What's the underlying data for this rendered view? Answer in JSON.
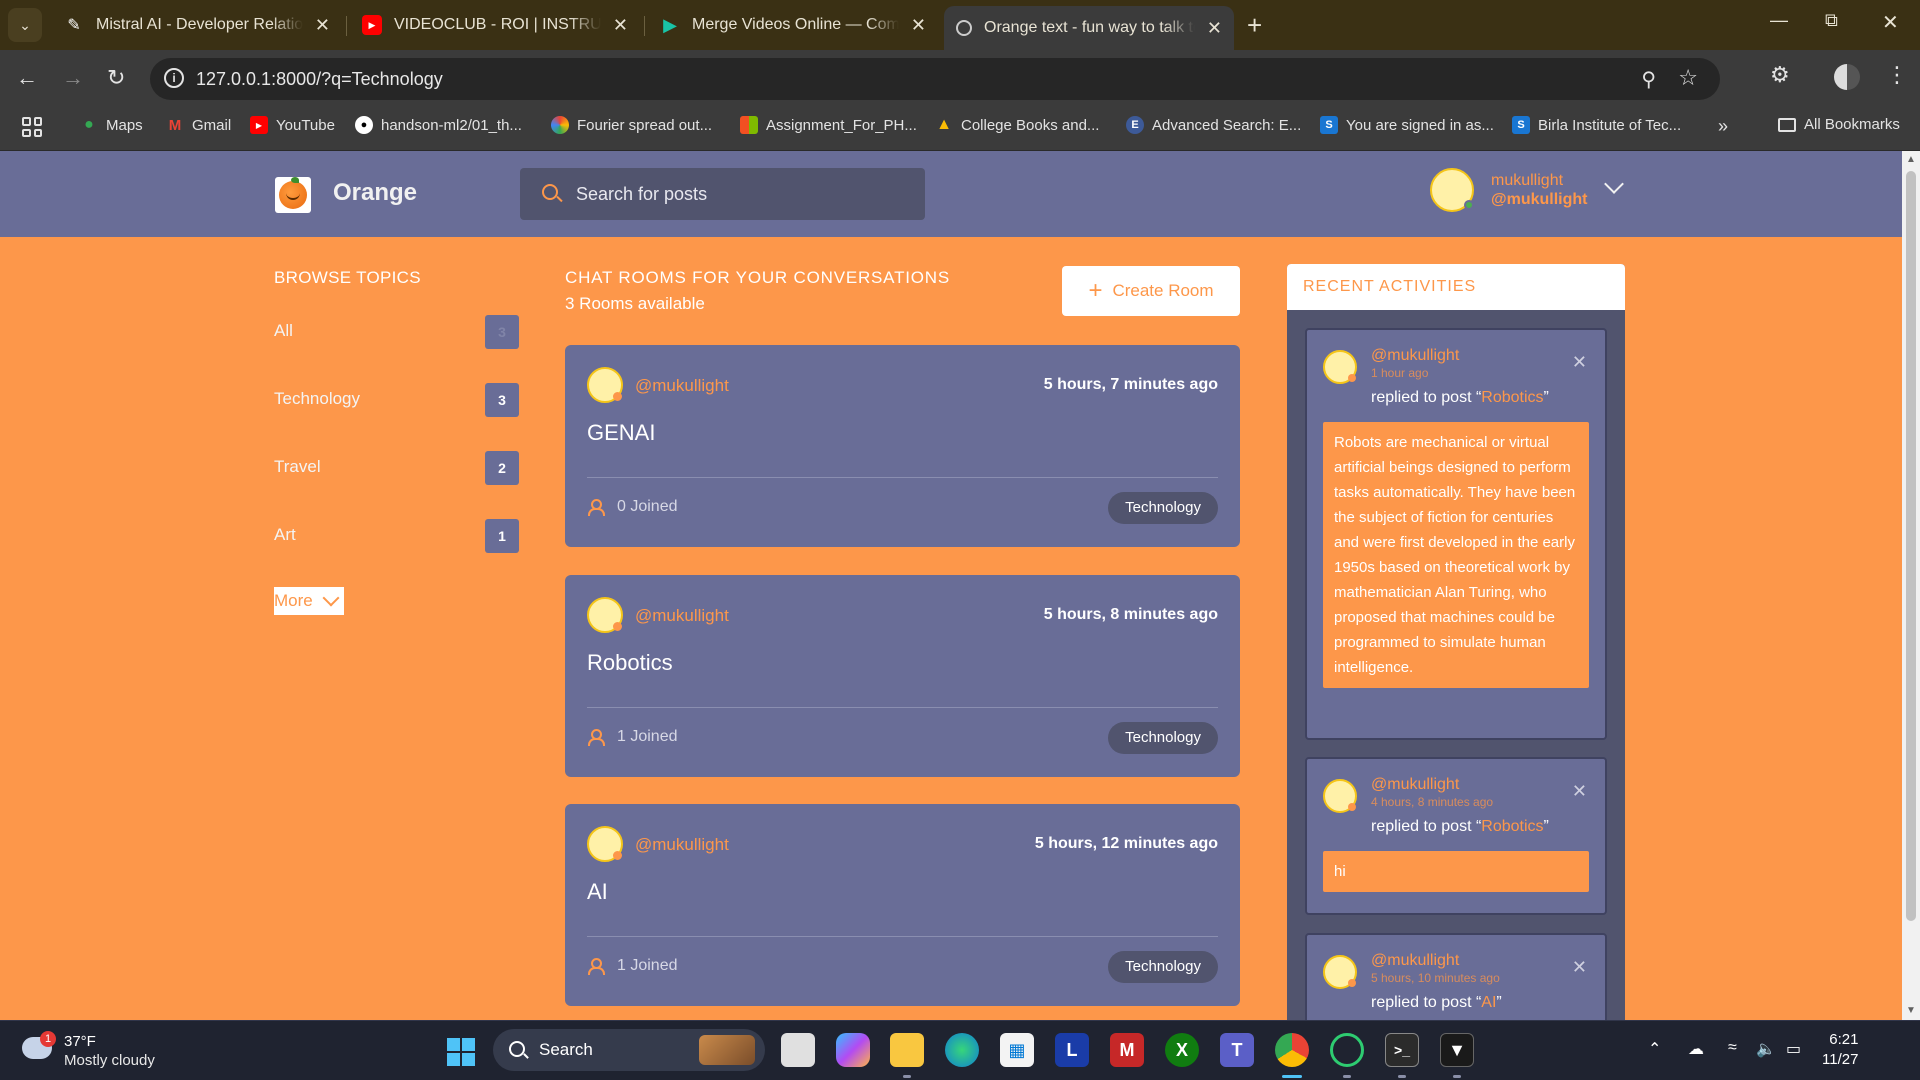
{
  "browser": {
    "tabs": [
      {
        "title": "Mistral AI - Developer Relations",
        "favicon": "pen-icon"
      },
      {
        "title": "VIDEOCLUB - ROI | INSTRUMENTAL",
        "favicon": "youtube-icon"
      },
      {
        "title": "Merge Videos Online — Combine",
        "favicon": "play-icon"
      },
      {
        "title": "Orange text - fun way to talk to",
        "favicon": "globe-icon",
        "active": true
      }
    ],
    "url": "127.0.0.1:8000/?q=Technology",
    "bookmarks": [
      "Maps",
      "Gmail",
      "YouTube",
      "handson-ml2/01_th...",
      "Fourier spread out...",
      "Assignment_For_PH...",
      "College Books and...",
      "Advanced Search: E...",
      "You are signed in as...",
      "Birla Institute of Tec..."
    ],
    "all_bookmarks_label": "All Bookmarks"
  },
  "site": {
    "brand": "Orange",
    "search_placeholder": "Search for posts",
    "user_name": "mukullight",
    "user_handle": "@mukullight"
  },
  "sidebar": {
    "title": "BROWSE TOPICS",
    "topics": [
      {
        "name": "All",
        "count": "3"
      },
      {
        "name": "Technology",
        "count": "3"
      },
      {
        "name": "Travel",
        "count": "2"
      },
      {
        "name": "Art",
        "count": "1"
      }
    ],
    "more_label": "More"
  },
  "rooms": {
    "title": "CHAT ROOMS FOR YOUR CONVERSATIONS",
    "count_text": "3 Rooms available",
    "create_label": "Create Room",
    "items": [
      {
        "host": "@mukullight",
        "time": "5 hours, 7 minutes ago",
        "name": "GENAI",
        "joined": "0 Joined",
        "topic": "Technology"
      },
      {
        "host": "@mukullight",
        "time": "5 hours, 8 minutes ago",
        "name": "Robotics",
        "joined": "1 Joined",
        "topic": "Technology"
      },
      {
        "host": "@mukullight",
        "time": "5 hours, 12 minutes ago",
        "name": "AI",
        "joined": "1 Joined",
        "topic": "Technology"
      }
    ]
  },
  "activity": {
    "title": "RECENT ACTIVITIES",
    "items": [
      {
        "user": "@mukullight",
        "time": "1 hour ago",
        "action": "replied to post “",
        "post": "Robotics",
        "end": "”",
        "body": "Robots are mechanical or virtual artificial beings designed to perform tasks automatically. They have been the subject of fiction for centuries and were first developed in the early 1950s based on theoretical work by mathematician Alan Turing, who proposed that machines could be programmed to simulate human intelligence."
      },
      {
        "user": "@mukullight",
        "time": "4 hours, 8 minutes ago",
        "action": "replied to post “",
        "post": "Robotics",
        "end": "”",
        "body": "hi"
      },
      {
        "user": "@mukullight",
        "time": "5 hours, 10 minutes ago",
        "action": "replied to post “",
        "post": "AI",
        "end": "”",
        "body": ""
      }
    ]
  },
  "taskbar": {
    "weather_temp": "37°F",
    "weather_desc": "Mostly cloudy",
    "weather_badge": "1",
    "search_label": "Search",
    "time": "6:21",
    "date": "11/27"
  }
}
